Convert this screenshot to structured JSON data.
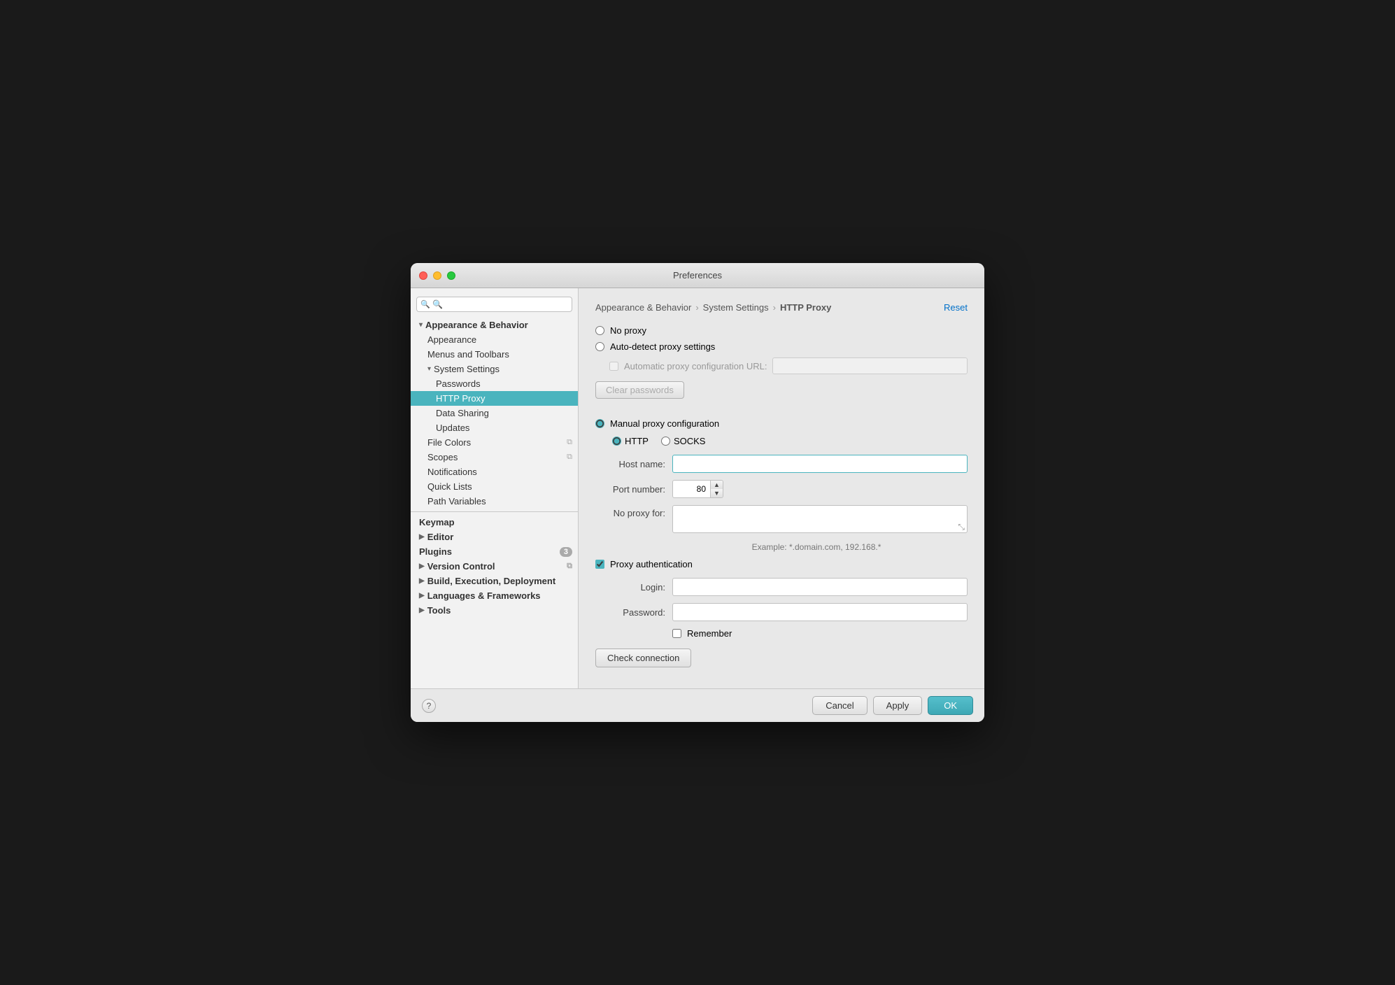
{
  "window": {
    "title": "Preferences"
  },
  "sidebar": {
    "search_placeholder": "🔍",
    "items": [
      {
        "id": "appearance-behavior",
        "label": "Appearance & Behavior",
        "indent": 0,
        "bold": true,
        "arrow": "▾",
        "selected": false
      },
      {
        "id": "appearance",
        "label": "Appearance",
        "indent": 1,
        "bold": false,
        "selected": false
      },
      {
        "id": "menus-toolbars",
        "label": "Menus and Toolbars",
        "indent": 1,
        "bold": false,
        "selected": false
      },
      {
        "id": "system-settings",
        "label": "System Settings",
        "indent": 1,
        "bold": false,
        "arrow": "▾",
        "selected": false
      },
      {
        "id": "passwords",
        "label": "Passwords",
        "indent": 2,
        "bold": false,
        "selected": false
      },
      {
        "id": "http-proxy",
        "label": "HTTP Proxy",
        "indent": 2,
        "bold": false,
        "selected": true
      },
      {
        "id": "data-sharing",
        "label": "Data Sharing",
        "indent": 2,
        "bold": false,
        "selected": false
      },
      {
        "id": "updates",
        "label": "Updates",
        "indent": 2,
        "bold": false,
        "selected": false
      },
      {
        "id": "file-colors",
        "label": "File Colors",
        "indent": 1,
        "bold": false,
        "selected": false,
        "has_copy": true
      },
      {
        "id": "scopes",
        "label": "Scopes",
        "indent": 1,
        "bold": false,
        "selected": false,
        "has_copy": true
      },
      {
        "id": "notifications",
        "label": "Notifications",
        "indent": 1,
        "bold": false,
        "selected": false
      },
      {
        "id": "quick-lists",
        "label": "Quick Lists",
        "indent": 1,
        "bold": false,
        "selected": false
      },
      {
        "id": "path-variables",
        "label": "Path Variables",
        "indent": 1,
        "bold": false,
        "selected": false
      },
      {
        "id": "keymap",
        "label": "Keymap",
        "indent": 0,
        "bold": true,
        "selected": false
      },
      {
        "id": "editor",
        "label": "Editor",
        "indent": 0,
        "bold": true,
        "arrow": "▶",
        "selected": false
      },
      {
        "id": "plugins",
        "label": "Plugins",
        "indent": 0,
        "bold": true,
        "selected": false,
        "badge": "3"
      },
      {
        "id": "version-control",
        "label": "Version Control",
        "indent": 0,
        "bold": true,
        "arrow": "▶",
        "selected": false,
        "has_copy": true
      },
      {
        "id": "build-execution",
        "label": "Build, Execution, Deployment",
        "indent": 0,
        "bold": true,
        "arrow": "▶",
        "selected": false
      },
      {
        "id": "languages-frameworks",
        "label": "Languages & Frameworks",
        "indent": 0,
        "bold": true,
        "arrow": "▶",
        "selected": false
      },
      {
        "id": "tools",
        "label": "Tools",
        "indent": 0,
        "bold": true,
        "arrow": "▶",
        "selected": false
      }
    ]
  },
  "main": {
    "breadcrumb": {
      "part1": "Appearance & Behavior",
      "sep1": "›",
      "part2": "System Settings",
      "sep2": "›",
      "part3": "HTTP Proxy"
    },
    "reset_label": "Reset",
    "no_proxy_label": "No proxy",
    "auto_detect_label": "Auto-detect proxy settings",
    "auto_url_label": "Automatic proxy configuration URL:",
    "auto_url_placeholder": "",
    "clear_passwords_label": "Clear passwords",
    "manual_proxy_label": "Manual proxy configuration",
    "http_label": "HTTP",
    "socks_label": "SOCKS",
    "host_name_label": "Host name:",
    "host_name_value": "",
    "port_number_label": "Port number:",
    "port_number_value": "80",
    "no_proxy_for_label": "No proxy for:",
    "no_proxy_for_value": "",
    "example_text": "Example: *.domain.com, 192.168.*",
    "proxy_auth_label": "Proxy authentication",
    "login_label": "Login:",
    "login_value": "",
    "password_label": "Password:",
    "password_value": "",
    "remember_label": "Remember",
    "check_connection_label": "Check connection"
  },
  "footer": {
    "cancel_label": "Cancel",
    "apply_label": "Apply",
    "ok_label": "OK"
  }
}
